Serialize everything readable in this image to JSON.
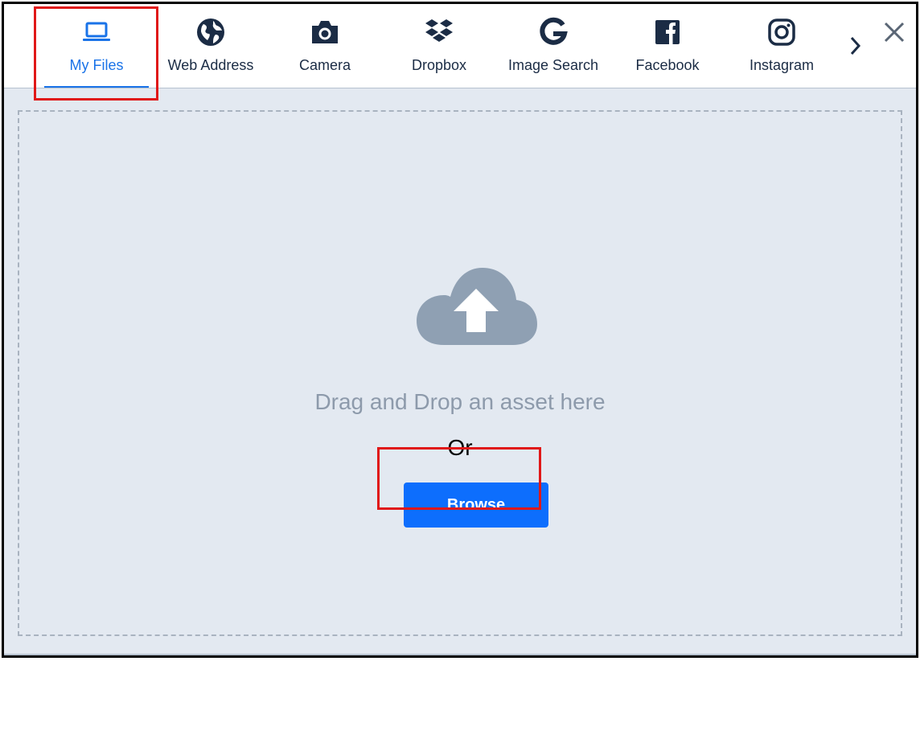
{
  "tabs": [
    {
      "label": "My Files",
      "icon": "laptop-icon",
      "active": true
    },
    {
      "label": "Web Address",
      "icon": "globe-icon",
      "active": false
    },
    {
      "label": "Camera",
      "icon": "camera-icon",
      "active": false
    },
    {
      "label": "Dropbox",
      "icon": "dropbox-icon",
      "active": false
    },
    {
      "label": "Image Search",
      "icon": "google-icon",
      "active": false
    },
    {
      "label": "Facebook",
      "icon": "facebook-icon",
      "active": false
    },
    {
      "label": "Instagram",
      "icon": "instagram-icon",
      "active": false
    }
  ],
  "dropzone": {
    "icon": "cloud-upload-icon",
    "drag_text": "Drag and Drop an asset here",
    "or_text": "Or",
    "browse_label": "Browse"
  },
  "colors": {
    "accent": "#1a73e8",
    "button": "#0d6efd",
    "icon": "#1b2c45",
    "highlight": "#e01818",
    "dropzone_bg": "#e3e9f1"
  }
}
